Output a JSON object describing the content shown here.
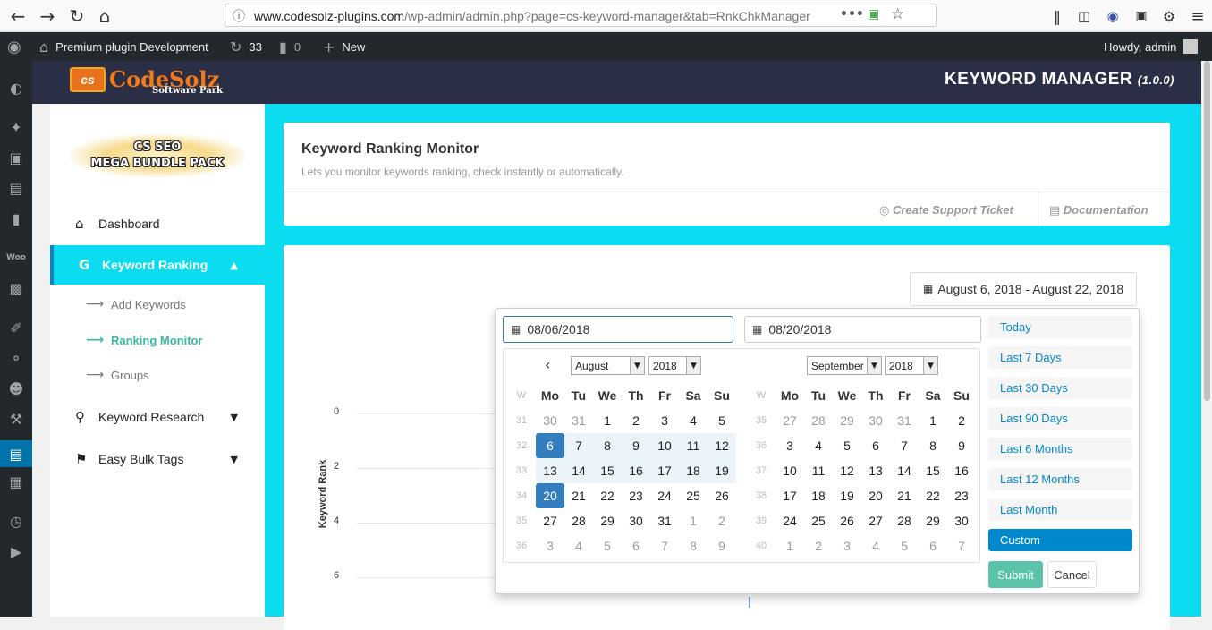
{
  "browser": {
    "url_prefix": "www.codesolz-plugins.com",
    "url_rest": "/wp-admin/admin.php?page=cs-keyword-manager&tab=RnkChkManager",
    "icons": [
      "back-icon",
      "forward-icon",
      "reload-icon",
      "home-icon",
      "info-icon",
      "more-icon",
      "pocket-icon",
      "shield-icon",
      "bookmark-star-icon",
      "library-icon",
      "sidebar-icon",
      "extension-icon",
      "screenshot-icon",
      "settings-icon",
      "menu-icon"
    ]
  },
  "adminbar": {
    "site_name": "Premium plugin Development",
    "updates_count": "33",
    "comments_count": "0",
    "new_label": "New",
    "howdy": "Howdy, admin"
  },
  "header": {
    "logo_badge": "cs",
    "logo_name": "CodeSolz",
    "logo_sub": "Software Park",
    "title": "KEYWORD MANAGER",
    "version": "(1.0.0)"
  },
  "nav": {
    "badge_line1": "CS SEO",
    "badge_line2": "MEGA BUNDLE PACK",
    "dashboard": "Dashboard",
    "keyword_ranking": "Keyword Ranking",
    "add_keywords": "Add Keywords",
    "ranking_monitor": "Ranking Monitor",
    "groups": "Groups",
    "keyword_research": "Keyword Research",
    "easy_bulk_tags": "Easy Bulk Tags"
  },
  "panel": {
    "title": "Keyword Ranking Monitor",
    "subtitle": "Lets you monitor keywords ranking, check instantly or automatically.",
    "support_link": "Create Support Ticket",
    "docs_link": "Documentation"
  },
  "chart_data": {
    "type": "line",
    "ylabel": "Keyword Rank",
    "y_ticks": [
      "0",
      "2",
      "4",
      "6"
    ],
    "series": []
  },
  "daterange": {
    "button_text": "August 6, 2018 - August 22, 2018",
    "start_input": "08/06/2018",
    "end_input": "08/20/2018",
    "left_month": "August",
    "left_year": "2018",
    "right_month": "September",
    "right_year": "2018",
    "weekdays": [
      "W",
      "Mo",
      "Tu",
      "We",
      "Th",
      "Fr",
      "Sa",
      "Su"
    ],
    "left_weeks": [
      [
        "31",
        "30",
        "31",
        "1",
        "2",
        "3",
        "4",
        "5"
      ],
      [
        "32",
        "6",
        "7",
        "8",
        "9",
        "10",
        "11",
        "12"
      ],
      [
        "33",
        "13",
        "14",
        "15",
        "16",
        "17",
        "18",
        "19"
      ],
      [
        "34",
        "20",
        "21",
        "22",
        "23",
        "24",
        "25",
        "26"
      ],
      [
        "35",
        "27",
        "28",
        "29",
        "30",
        "31",
        "1",
        "2"
      ],
      [
        "36",
        "3",
        "4",
        "5",
        "6",
        "7",
        "8",
        "9"
      ]
    ],
    "right_weeks": [
      [
        "35",
        "27",
        "28",
        "29",
        "30",
        "31",
        "1",
        "2"
      ],
      [
        "36",
        "3",
        "4",
        "5",
        "6",
        "7",
        "8",
        "9"
      ],
      [
        "37",
        "10",
        "11",
        "12",
        "13",
        "14",
        "15",
        "16"
      ],
      [
        "38",
        "17",
        "18",
        "19",
        "20",
        "21",
        "22",
        "23"
      ],
      [
        "39",
        "24",
        "25",
        "26",
        "27",
        "28",
        "29",
        "30"
      ],
      [
        "40",
        "1",
        "2",
        "3",
        "4",
        "5",
        "6",
        "7"
      ]
    ],
    "ranges": [
      "Today",
      "Last 7 Days",
      "Last 30 Days",
      "Last 90 Days",
      "Last 6 Months",
      "Last 12 Months",
      "Last Month",
      "Custom"
    ],
    "selected_range": "Custom",
    "submit": "Submit",
    "cancel": "Cancel"
  }
}
